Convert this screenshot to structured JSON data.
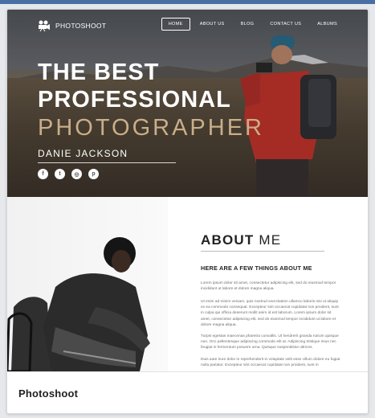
{
  "brand": {
    "name": "PHOTOSHOOT",
    "icon": "movie-camera-icon"
  },
  "nav": {
    "items": [
      {
        "label": "HOME",
        "active": true
      },
      {
        "label": "ABOUT US",
        "active": false
      },
      {
        "label": "BLOG",
        "active": false
      },
      {
        "label": "CONTACT US",
        "active": false
      },
      {
        "label": "ALBUMS",
        "active": false
      }
    ]
  },
  "hero": {
    "line1": "THE BEST",
    "line2": "PROFESSIONAL",
    "line3": "PHOTOGRAPHER",
    "name": "DANIE JACKSON",
    "socials": [
      {
        "icon": "facebook-icon",
        "glyph": "f"
      },
      {
        "icon": "twitter-icon",
        "glyph": "t"
      },
      {
        "icon": "instagram-icon",
        "glyph": "◎"
      },
      {
        "icon": "pinterest-icon",
        "glyph": "p"
      }
    ],
    "accent_color": "#c9ae8a"
  },
  "about": {
    "title_bold": "ABOUT",
    "title_rest": "ME",
    "subtitle": "HERE ARE A FEW THINGS ABOUT ME",
    "paragraphs": [
      "Lorem ipsum dolor sit amet, consectetur adipiscing elit, sed do eiusmod tempor incididunt ut labore et dolore magna aliqua.",
      "Ut enim ad minim veniam, quis nostrud exercitation ullamco laboris nisi ut aliquip ex ea commodo consequat. Excepteur sint occaecat cupidatat non proident, sunt in culpa qui officia deserunt mollit anim id est laborum. Lorem ipsum dolor sit amet, consectetur adipiscing elit, sed do eiusmod tempor incididunt ut labore et dolore magna aliqua.",
      "Turpis egestas maecenas pharetra convallis. Ut hendrerit gravida rutrum quisque non. Orci pellentesque adipiscing commodo elit at. Adipiscing tristique risus nec feugiat in fermentum posuere urna. Quisque suspendisse ultrices.",
      "Duis aute irure dolor in reprehenderit in voluptate velit esse cillum dolore eu fugiat nulla pariatur. Excepteur sint occaecat cupidatat non proident, sunt in"
    ]
  },
  "footer": {
    "title": "Photoshoot"
  }
}
